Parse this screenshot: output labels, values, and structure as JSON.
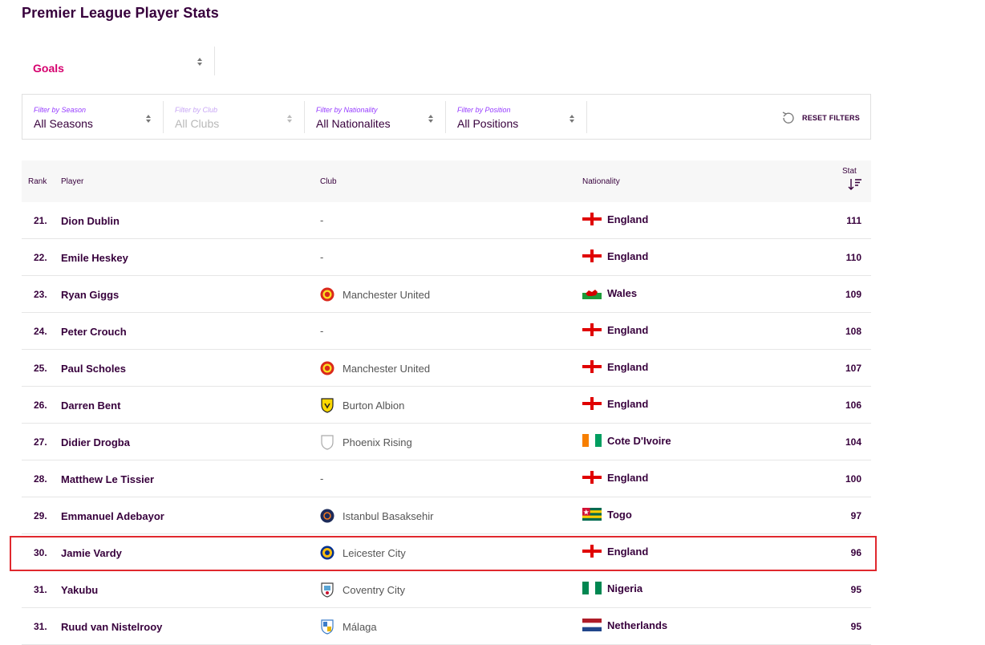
{
  "page": {
    "title": "Premier League Player Stats"
  },
  "stat_selector": {
    "value": "Goals"
  },
  "filters": [
    {
      "label": "Filter by Season",
      "value": "All Seasons",
      "disabled": false
    },
    {
      "label": "Filter by Club",
      "value": "All Clubs",
      "disabled": true
    },
    {
      "label": "Filter by Nationality",
      "value": "All Nationalites",
      "disabled": false
    },
    {
      "label": "Filter by Position",
      "value": "All Positions",
      "disabled": false
    }
  ],
  "reset_label": "RESET FILTERS",
  "table": {
    "headers": {
      "rank": "Rank",
      "player": "Player",
      "club": "Club",
      "nationality": "Nationality",
      "stat": "Stat"
    },
    "rows": [
      {
        "rank": "21.",
        "player": "Dion Dublin",
        "club": "-",
        "crest": "none",
        "nationality": "England",
        "flag": "england",
        "stat": "111"
      },
      {
        "rank": "22.",
        "player": "Emile Heskey",
        "club": "-",
        "crest": "none",
        "nationality": "England",
        "flag": "england",
        "stat": "110"
      },
      {
        "rank": "23.",
        "player": "Ryan Giggs",
        "club": "Manchester United",
        "crest": "man-utd",
        "nationality": "Wales",
        "flag": "wales",
        "stat": "109"
      },
      {
        "rank": "24.",
        "player": "Peter Crouch",
        "club": "-",
        "crest": "none",
        "nationality": "England",
        "flag": "england",
        "stat": "108"
      },
      {
        "rank": "25.",
        "player": "Paul Scholes",
        "club": "Manchester United",
        "crest": "man-utd",
        "nationality": "England",
        "flag": "england",
        "stat": "107"
      },
      {
        "rank": "26.",
        "player": "Darren Bent",
        "club": "Burton Albion",
        "crest": "burton",
        "nationality": "England",
        "flag": "england",
        "stat": "106"
      },
      {
        "rank": "27.",
        "player": "Didier Drogba",
        "club": "Phoenix Rising",
        "crest": "phoenix",
        "nationality": "Cote D'Ivoire",
        "flag": "ivory-coast",
        "stat": "104"
      },
      {
        "rank": "28.",
        "player": "Matthew Le Tissier",
        "club": "-",
        "crest": "none",
        "nationality": "England",
        "flag": "england",
        "stat": "100"
      },
      {
        "rank": "29.",
        "player": "Emmanuel Adebayor",
        "club": "Istanbul Basaksehir",
        "crest": "basaksehir",
        "nationality": "Togo",
        "flag": "togo",
        "stat": "97"
      },
      {
        "rank": "30.",
        "player": "Jamie Vardy",
        "club": "Leicester City",
        "crest": "leicester",
        "nationality": "England",
        "flag": "england",
        "stat": "96",
        "highlighted": true
      },
      {
        "rank": "31.",
        "player": "Yakubu",
        "club": "Coventry City",
        "crest": "coventry",
        "nationality": "Nigeria",
        "flag": "nigeria",
        "stat": "95"
      },
      {
        "rank": "31.",
        "player": "Ruud van Nistelrooy",
        "club": "Málaga",
        "crest": "malaga",
        "nationality": "Netherlands",
        "flag": "netherlands",
        "stat": "95"
      }
    ]
  },
  "colors": {
    "primary": "#37003c",
    "accent": "#d6006e",
    "filter_label": "#963cff",
    "highlight": "#e0282e"
  }
}
